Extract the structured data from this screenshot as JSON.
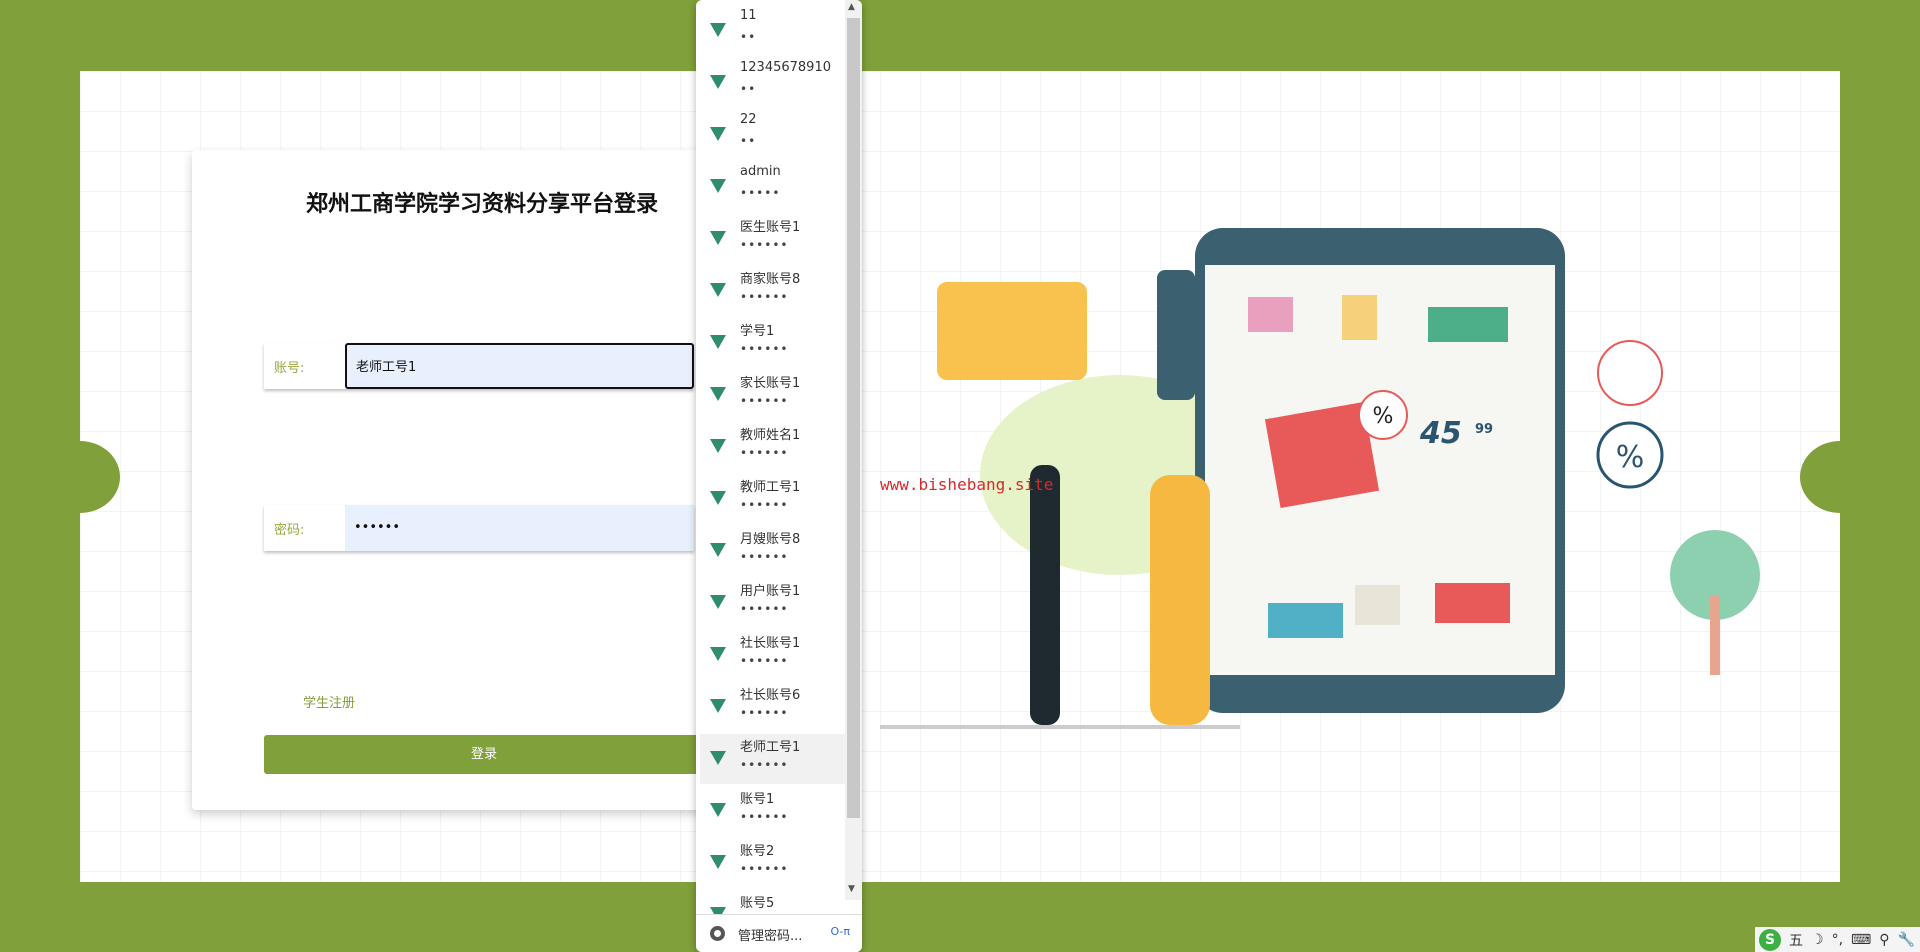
{
  "login": {
    "title": "郑州工商学院学习资料分享平台登录",
    "account_label": "账号:",
    "account_value": "老师工号1",
    "password_label": "密码:",
    "password_value": "••••••",
    "register_link": "学生注册",
    "login_button": "登录"
  },
  "watermark": "www.bishebang.site",
  "illustration": {
    "price": "45",
    "cents": "99",
    "percent": "%"
  },
  "autofill": {
    "items": [
      {
        "user": "11",
        "pass": "••"
      },
      {
        "user": "12345678910",
        "pass": "••"
      },
      {
        "user": "22",
        "pass": "••"
      },
      {
        "user": "admin",
        "pass": "•••••"
      },
      {
        "user": "医生账号1",
        "pass": "••••••"
      },
      {
        "user": "商家账号8",
        "pass": "••••••"
      },
      {
        "user": "学号1",
        "pass": "••••••"
      },
      {
        "user": "家长账号1",
        "pass": "••••••"
      },
      {
        "user": "教师姓名1",
        "pass": "••••••"
      },
      {
        "user": "教师工号1",
        "pass": "••••••"
      },
      {
        "user": "月嫂账号8",
        "pass": "••••••"
      },
      {
        "user": "用户账号1",
        "pass": "••••••"
      },
      {
        "user": "社长账号1",
        "pass": "••••••"
      },
      {
        "user": "社长账号6",
        "pass": "••••••"
      },
      {
        "user": "老师工号1",
        "pass": "••••••"
      },
      {
        "user": "账号1",
        "pass": "••••••"
      },
      {
        "user": "账号2",
        "pass": "••••••"
      },
      {
        "user": "账号5",
        "pass": ""
      }
    ],
    "highlighted_index": 14,
    "manage_label": "管理密码...",
    "key_icon": "O-π"
  },
  "ime": {
    "mode": "五",
    "items": [
      "☽",
      "°,",
      "⌨",
      "⚲",
      "🔧"
    ]
  },
  "colors": {
    "brand": "#7fa03a",
    "vue": "#2f8d6c"
  }
}
